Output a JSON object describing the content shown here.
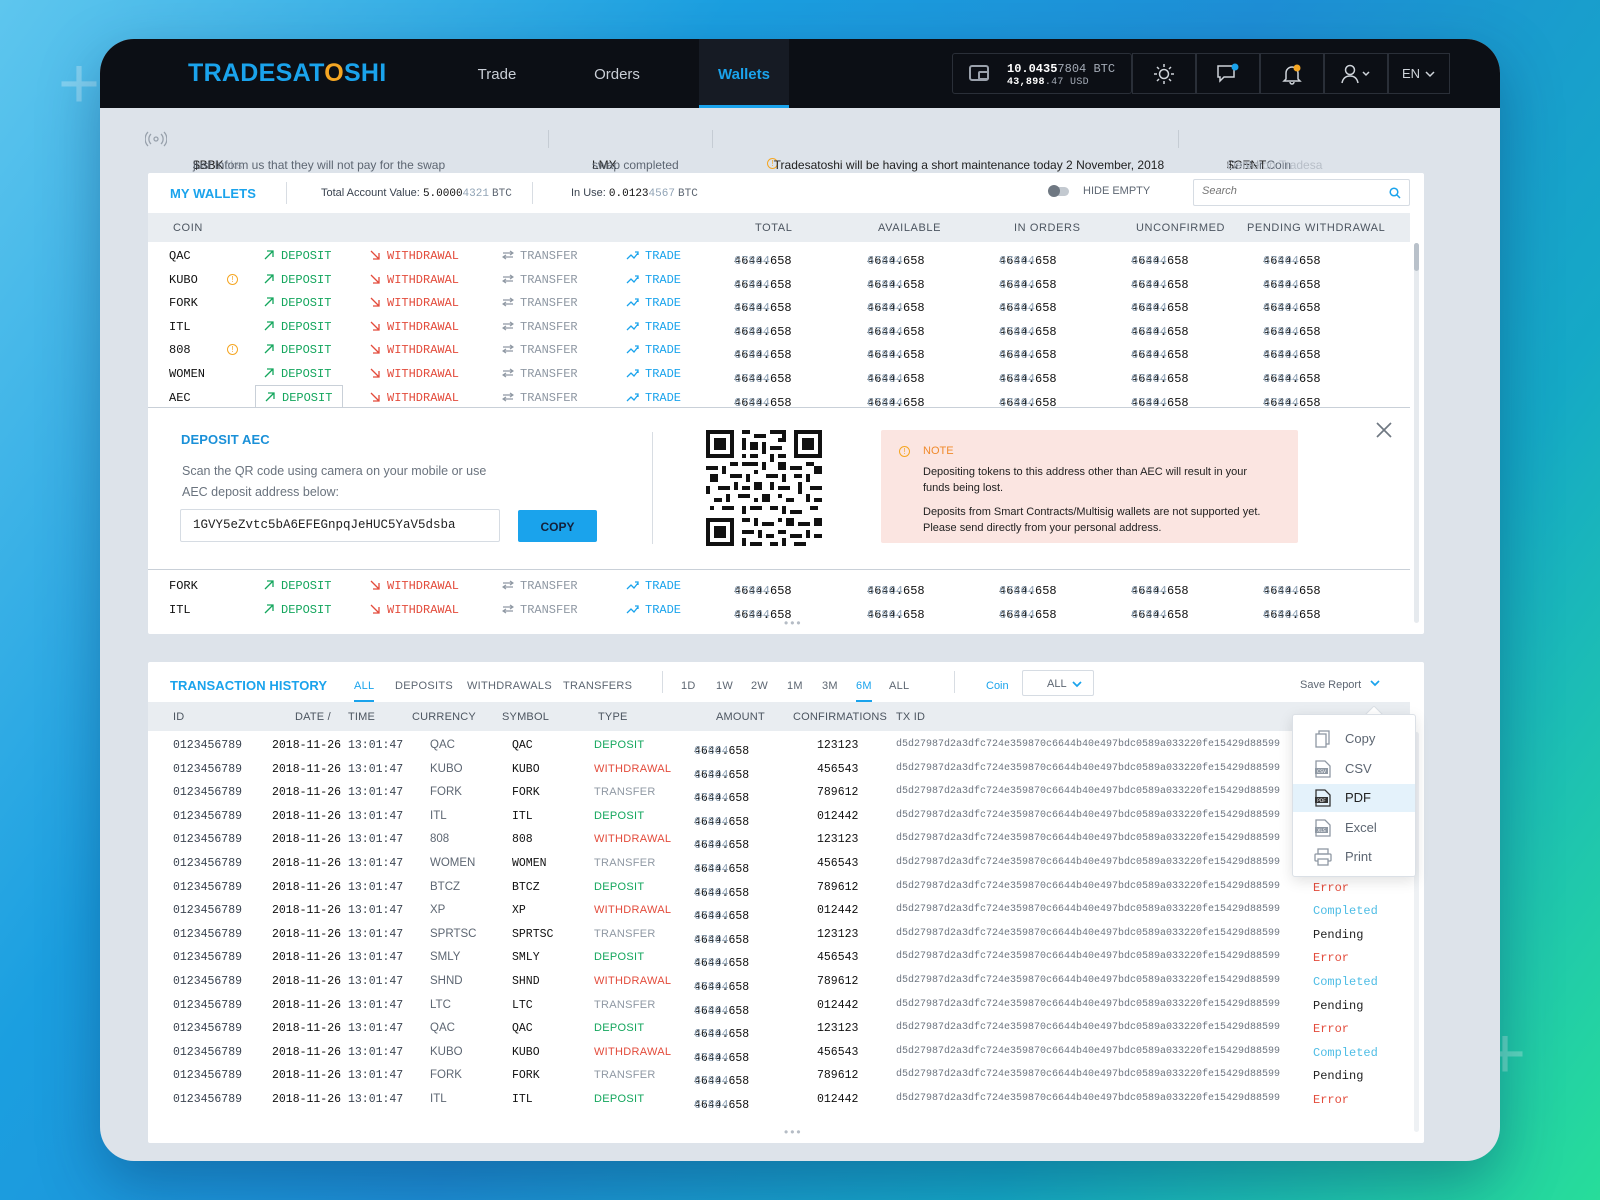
{
  "app": {
    "logo_a": "TRADESAT",
    "logo_b": "O",
    "logo_c": "SHI",
    "brand_color": "#1aa3ec"
  },
  "nav": {
    "trade": "Trade",
    "orders": "Orders",
    "wallets": "Wallets"
  },
  "balance": {
    "btc_main": "10.0435",
    "btc_tail": "7804",
    "btc_unit": "BTC",
    "usd_main": "43,898",
    "usd_tail": ".47",
    "usd_unit": "USD"
  },
  "lang": "EN",
  "icons": {
    "wallet": "wallet-icon",
    "theme": "sun-icon",
    "chat": "chat-icon",
    "bell": "bell-icon",
    "user": "user-icon"
  },
  "ticker": [
    {
      "pre": "BitBlocks ",
      "strong": "$BBK",
      "post": " just inform us that they will not pay for the swap"
    },
    {
      "pre": "",
      "strong": "LMX",
      "post": " swap completed"
    },
    {
      "pre": "",
      "strong": "Tradesatoshi will be having a short maintenance today 2 November, 2018",
      "post": ""
    },
    {
      "pre": "Center Coin ",
      "strong": "$CENT",
      "post": " Listed on Tradesa"
    }
  ],
  "wallets": {
    "title": "MY WALLETS",
    "total_label": "Total Account Value:",
    "total_main": "5.0000",
    "total_tail": "4321",
    "total_unit": "BTC",
    "inuse_label": "In Use:",
    "inuse_main": "0.0123",
    "inuse_tail": "4567",
    "inuse_unit": "BTC",
    "hide_empty": "HIDE EMPTY",
    "search_placeholder": "Search",
    "columns": [
      "COIN",
      "TOTAL",
      "AVAILABLE",
      "IN ORDERS",
      "UNCONFIRMED",
      "PENDING WITHDRAWAL"
    ],
    "actions": {
      "deposit": "DEPOSIT",
      "withdrawal": "WITHDRAWAL",
      "transfer": "TRANSFER",
      "trade": "TRADE"
    },
    "num_main": "4644.658",
    "num_tail": "67804",
    "rows_top": [
      {
        "coin": "QAC",
        "warn": false
      },
      {
        "coin": "KUBO",
        "warn": true
      },
      {
        "coin": "FORK",
        "warn": false
      },
      {
        "coin": "ITL",
        "warn": false
      },
      {
        "coin": "808",
        "warn": true
      },
      {
        "coin": "WOMEN",
        "warn": false
      },
      {
        "coin": "AEC",
        "warn": false
      }
    ],
    "rows_bottom": [
      {
        "coin": "FORK",
        "warn": false
      },
      {
        "coin": "ITL",
        "warn": false
      }
    ]
  },
  "deposit": {
    "title": "DEPOSIT AEC",
    "desc1": "Scan the QR code using camera on your mobile or use",
    "desc2": "AEC deposit address below:",
    "address": "1GVY5eZvtc5bA6EFEGnpqJeHUC5YaV5dsba",
    "copy": "COPY",
    "note_title": "NOTE",
    "note1a": "Depositing tokens to this address other than AEC will result in your",
    "note1b": "funds being lost.",
    "note2a": "Deposits from Smart Contracts/Multisig wallets are not supported yet.",
    "note2b": "Please send directly from your personal address."
  },
  "history": {
    "title": "TRANSACTION HISTORY",
    "type_tabs": [
      "ALL",
      "DEPOSITS",
      "WITHDRAWALS",
      "TRANSFERS"
    ],
    "period_tabs": [
      "1D",
      "1W",
      "2W",
      "1M",
      "3M",
      "6M",
      "ALL"
    ],
    "coin_label": "Coin",
    "coin_value": "ALL",
    "save_report": "Save Report",
    "columns": [
      "ID",
      "DATE /",
      "TIME",
      "CURRENCY",
      "SYMBOL",
      "TYPE",
      "AMOUNT",
      "CONFIRMATIONS",
      "TX ID"
    ],
    "id": "0123456789",
    "date": "2018-11-26",
    "time": "13:01:47",
    "amount_main": "4644.658",
    "amount_tail": "67804",
    "txid": "d5d27987d2a3dfc724e359870c6644b40e497bdc0589a033220fe15429d88599",
    "rows": [
      {
        "cur": "QAC",
        "type": "DEPOSIT",
        "conf": "123123",
        "status": ""
      },
      {
        "cur": "KUBO",
        "type": "WITHDRAWAL",
        "conf": "456543",
        "status": ""
      },
      {
        "cur": "FORK",
        "type": "TRANSFER",
        "conf": "789612",
        "status": ""
      },
      {
        "cur": "ITL",
        "type": "DEPOSIT",
        "conf": "012442",
        "status": ""
      },
      {
        "cur": "808",
        "type": "WITHDRAWAL",
        "conf": "123123",
        "status": ""
      },
      {
        "cur": "WOMEN",
        "type": "TRANSFER",
        "conf": "456543",
        "status": ""
      },
      {
        "cur": "BTCZ",
        "type": "DEPOSIT",
        "conf": "789612",
        "status": "Error"
      },
      {
        "cur": "XP",
        "type": "WITHDRAWAL",
        "conf": "012442",
        "status": "Completed"
      },
      {
        "cur": "SPRTSC",
        "type": "TRANSFER",
        "conf": "123123",
        "status": "Pending"
      },
      {
        "cur": "SMLY",
        "type": "DEPOSIT",
        "conf": "456543",
        "status": "Error"
      },
      {
        "cur": "SHND",
        "type": "WITHDRAWAL",
        "conf": "789612",
        "status": "Completed"
      },
      {
        "cur": "LTC",
        "type": "TRANSFER",
        "conf": "012442",
        "status": "Pending"
      },
      {
        "cur": "QAC",
        "type": "DEPOSIT",
        "conf": "123123",
        "status": "Error"
      },
      {
        "cur": "KUBO",
        "type": "WITHDRAWAL",
        "conf": "456543",
        "status": "Completed"
      },
      {
        "cur": "FORK",
        "type": "TRANSFER",
        "conf": "789612",
        "status": "Pending"
      },
      {
        "cur": "ITL",
        "type": "DEPOSIT",
        "conf": "012442",
        "status": "Error"
      }
    ],
    "menu": [
      {
        "label": "Copy",
        "icon": "copy-icon"
      },
      {
        "label": "CSV",
        "icon": "csv-file-icon"
      },
      {
        "label": "PDF",
        "icon": "pdf-file-icon"
      },
      {
        "label": "Excel",
        "icon": "excel-file-icon"
      },
      {
        "label": "Print",
        "icon": "printer-icon"
      }
    ],
    "menu_selected": "PDF"
  }
}
